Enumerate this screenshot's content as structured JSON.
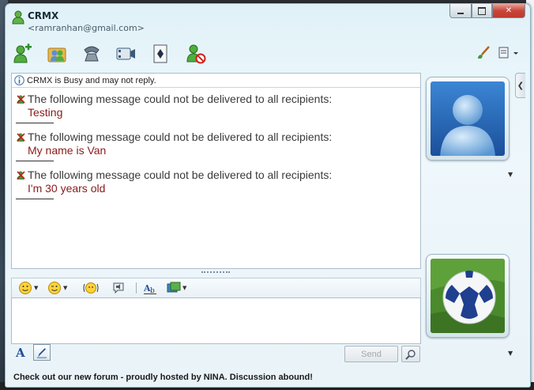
{
  "window": {
    "contact_name": "CRMX",
    "contact_email": "<ramranhan@gmail.com>",
    "controls": {
      "minimize": "▭",
      "maximize": "▢",
      "close": "✕"
    }
  },
  "toolbar": {
    "icons": [
      "add-contact-icon",
      "share-folder-icon",
      "voice-call-icon",
      "video-icon",
      "games-icon",
      "block-contact-icon"
    ],
    "right_icons": [
      "paintbrush-icon",
      "menu-dropdown-icon"
    ]
  },
  "conversation": {
    "busy_notice": "CRMX is Busy and may not reply.",
    "messages": [
      {
        "error": "The following message could not be delivered to all recipients:",
        "text": "Testing"
      },
      {
        "error": "The following message could not be delivered to all recipients:",
        "text": "My name is Van"
      },
      {
        "error": "The following message could not be delivered to all recipients:",
        "text": "I'm 30 years old"
      }
    ]
  },
  "compose": {
    "tools": [
      "emoticon-icon",
      "wink-icon",
      "nudge-icon",
      "voice-clip-icon",
      "font-icon",
      "background-icon"
    ],
    "value": "",
    "send_label": "Send",
    "format_font_label": "A"
  },
  "status": {
    "message": "Check out our new forum - proudly hosted by NINA. Discussion abound!"
  },
  "colors": {
    "error_text": "#3a3a3a",
    "message_text": "#8b1a1a",
    "accent": "#1f4e9b"
  }
}
